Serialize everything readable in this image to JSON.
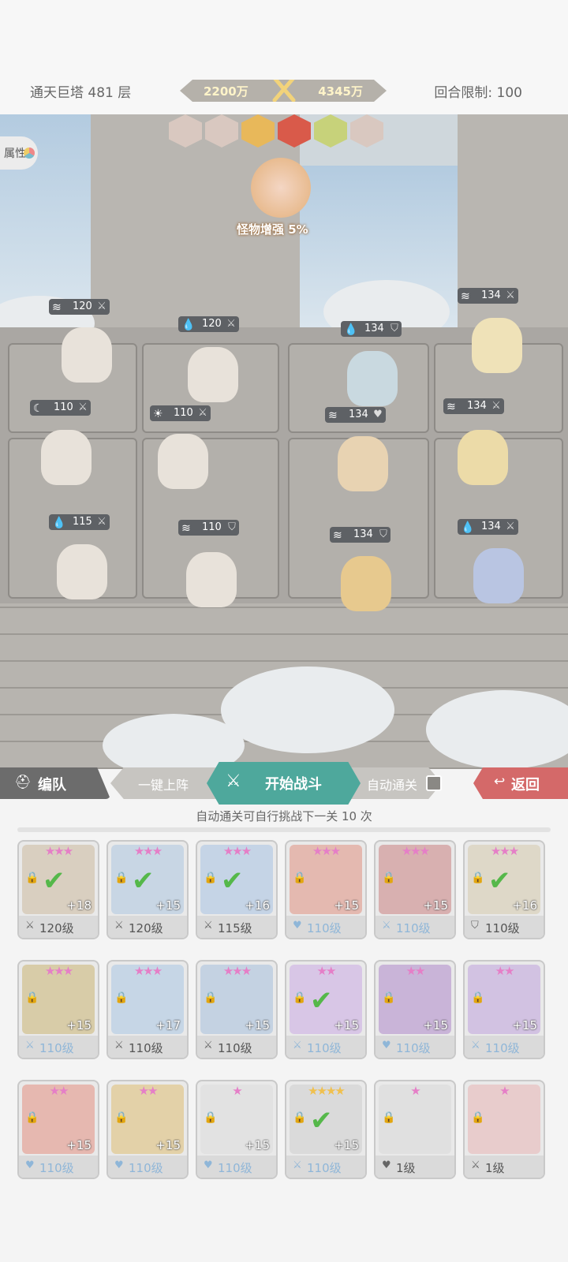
{
  "header": {
    "floor_label": "通天巨塔 481 层",
    "power_left": "2200万",
    "power_right": "4345万",
    "turn_limit": "回合限制: 100"
  },
  "field": {
    "attr_button": "属性",
    "buff_text": "怪物增强 5%",
    "ally_tags": [
      {
        "elem": "wind",
        "value": "120",
        "role": "sword"
      },
      {
        "elem": "water",
        "value": "120",
        "role": "sword"
      },
      {
        "elem": "moon",
        "value": "110",
        "role": "sword"
      },
      {
        "elem": "sun",
        "value": "110",
        "role": "sword"
      },
      {
        "elem": "water",
        "value": "115",
        "role": "sword"
      },
      {
        "elem": "wind",
        "value": "110",
        "role": "shield"
      }
    ],
    "enemy_tags": [
      {
        "elem": "water",
        "value": "134",
        "role": "shield"
      },
      {
        "elem": "wind",
        "value": "134",
        "role": "sword"
      },
      {
        "elem": "wind",
        "value": "134",
        "role": "heart"
      },
      {
        "elem": "wind",
        "value": "134",
        "role": "sword"
      },
      {
        "elem": "wind",
        "value": "134",
        "role": "shield"
      },
      {
        "elem": "water",
        "value": "134",
        "role": "sword"
      }
    ]
  },
  "controls": {
    "team": "编队",
    "quick_deploy": "一键上阵",
    "start_battle": "开始战斗",
    "auto_clear": "自动通关",
    "back": "返回",
    "hint": "自动通关可自行挑战下一关 10 次"
  },
  "heroes": [
    {
      "stars": "★★★",
      "star_color": "pink",
      "deployed": true,
      "plus": "+18",
      "level": "120级",
      "role": "sword",
      "dim": false
    },
    {
      "stars": "★★★",
      "star_color": "pink",
      "deployed": true,
      "plus": "+15",
      "level": "120级",
      "role": "sword",
      "dim": false
    },
    {
      "stars": "★★★",
      "star_color": "pink",
      "deployed": true,
      "plus": "+16",
      "level": "115级",
      "role": "sword",
      "dim": false
    },
    {
      "stars": "★★★",
      "star_color": "pink",
      "deployed": false,
      "plus": "+15",
      "level": "110级",
      "role": "heart",
      "dim": true
    },
    {
      "stars": "★★★",
      "star_color": "pink",
      "deployed": false,
      "plus": "+15",
      "level": "110级",
      "role": "sword",
      "dim": true
    },
    {
      "stars": "★★★",
      "star_color": "pink",
      "deployed": true,
      "plus": "+16",
      "level": "110级",
      "role": "shield",
      "dim": false
    },
    {
      "stars": "★★★",
      "star_color": "pink",
      "deployed": false,
      "plus": "+15",
      "level": "110级",
      "role": "sword",
      "dim": true
    },
    {
      "stars": "★★★",
      "star_color": "pink",
      "deployed": false,
      "plus": "+17",
      "level": "110级",
      "role": "sword",
      "dim": false
    },
    {
      "stars": "★★★",
      "star_color": "pink",
      "deployed": false,
      "plus": "+15",
      "level": "110级",
      "role": "sword",
      "dim": false
    },
    {
      "stars": "★★",
      "star_color": "pink",
      "deployed": true,
      "plus": "+15",
      "level": "110级",
      "role": "sword",
      "dim": true
    },
    {
      "stars": "★★",
      "star_color": "pink",
      "deployed": false,
      "plus": "+15",
      "level": "110级",
      "role": "heart",
      "dim": true
    },
    {
      "stars": "★★",
      "star_color": "pink",
      "deployed": false,
      "plus": "+15",
      "level": "110级",
      "role": "sword",
      "dim": true
    },
    {
      "stars": "★★",
      "star_color": "pink",
      "deployed": false,
      "plus": "+15",
      "level": "110级",
      "role": "heart",
      "dim": true
    },
    {
      "stars": "★★",
      "star_color": "pink",
      "deployed": false,
      "plus": "+15",
      "level": "110级",
      "role": "heart",
      "dim": true
    },
    {
      "stars": "★",
      "star_color": "pink",
      "deployed": false,
      "plus": "+15",
      "level": "110级",
      "role": "heart",
      "dim": true
    },
    {
      "stars": "★★★★",
      "star_color": "gold",
      "deployed": true,
      "plus": "+15",
      "level": "110级",
      "role": "sword",
      "dim": true
    },
    {
      "stars": "★",
      "star_color": "pink",
      "deployed": false,
      "plus": "",
      "level": "1级",
      "role": "heart",
      "dim": false
    },
    {
      "stars": "★",
      "star_color": "pink",
      "deployed": false,
      "plus": "",
      "level": "1级",
      "role": "sword",
      "dim": false
    }
  ],
  "colors": {
    "start_button": "#4ea89c",
    "back_button": "#d46969",
    "deployed_check": "#55b84a",
    "pink_star": "#e57fc7",
    "gold_star": "#f0c04e"
  }
}
